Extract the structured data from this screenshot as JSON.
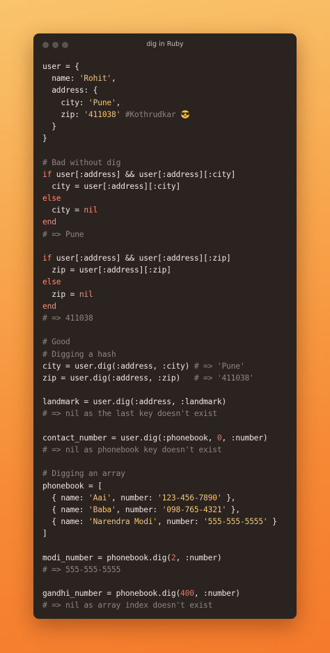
{
  "window": {
    "title": "dig in Ruby"
  },
  "colors": {
    "background": "#2b2320",
    "text": "#ece6e2",
    "keyword": "#ff8a73",
    "string": "#f3c56b",
    "comment": "#8d8580",
    "number": "#f0725b"
  },
  "code": [
    {
      "t": [
        {
          "v": "user = {"
        }
      ]
    },
    {
      "t": [
        {
          "v": "  name: "
        },
        {
          "v": "'Rohit'",
          "c": "str"
        },
        {
          "v": ","
        }
      ]
    },
    {
      "t": [
        {
          "v": "  address: {"
        }
      ]
    },
    {
      "t": [
        {
          "v": "    city: "
        },
        {
          "v": "'Pune'",
          "c": "str"
        },
        {
          "v": ","
        }
      ]
    },
    {
      "t": [
        {
          "v": "    zip: "
        },
        {
          "v": "'411038'",
          "c": "str"
        },
        {
          "v": " "
        },
        {
          "v": "#Kothrudkar 😎",
          "c": "cm"
        }
      ]
    },
    {
      "t": [
        {
          "v": "  }"
        }
      ]
    },
    {
      "t": [
        {
          "v": "}"
        }
      ]
    },
    {
      "t": []
    },
    {
      "t": [
        {
          "v": "# Bad without dig",
          "c": "cm"
        }
      ]
    },
    {
      "t": [
        {
          "v": "if",
          "c": "kw"
        },
        {
          "v": " user[:address] && user[:address][:city]"
        }
      ]
    },
    {
      "t": [
        {
          "v": "  city = user[:address][:city]"
        }
      ]
    },
    {
      "t": [
        {
          "v": "else",
          "c": "kw"
        }
      ]
    },
    {
      "t": [
        {
          "v": "  city = "
        },
        {
          "v": "nil",
          "c": "kw"
        }
      ]
    },
    {
      "t": [
        {
          "v": "end",
          "c": "kw"
        }
      ]
    },
    {
      "t": [
        {
          "v": "# => Pune",
          "c": "cm"
        }
      ]
    },
    {
      "t": []
    },
    {
      "t": [
        {
          "v": "if",
          "c": "kw"
        },
        {
          "v": " user[:address] && user[:address][:zip]"
        }
      ]
    },
    {
      "t": [
        {
          "v": "  zip = user[:address][:zip]"
        }
      ]
    },
    {
      "t": [
        {
          "v": "else",
          "c": "kw"
        }
      ]
    },
    {
      "t": [
        {
          "v": "  zip = "
        },
        {
          "v": "nil",
          "c": "kw"
        }
      ]
    },
    {
      "t": [
        {
          "v": "end",
          "c": "kw"
        }
      ]
    },
    {
      "t": [
        {
          "v": "# => 411038",
          "c": "cm"
        }
      ]
    },
    {
      "t": []
    },
    {
      "t": [
        {
          "v": "# Good",
          "c": "cm"
        }
      ]
    },
    {
      "t": [
        {
          "v": "# Digging a hash",
          "c": "cm"
        }
      ]
    },
    {
      "t": [
        {
          "v": "city = user.dig(:address, :city) "
        },
        {
          "v": "# => 'Pune'",
          "c": "cm"
        }
      ]
    },
    {
      "t": [
        {
          "v": "zip = user.dig(:address, :zip)   "
        },
        {
          "v": "# => '411038'",
          "c": "cm"
        }
      ]
    },
    {
      "t": []
    },
    {
      "t": [
        {
          "v": "landmark = user.dig(:address, :landmark)"
        }
      ]
    },
    {
      "t": [
        {
          "v": "# => nil as the last key doesn't exist",
          "c": "cm"
        }
      ]
    },
    {
      "t": []
    },
    {
      "t": [
        {
          "v": "contact_number = user.dig(:phonebook, "
        },
        {
          "v": "0",
          "c": "num"
        },
        {
          "v": ", :number)"
        }
      ]
    },
    {
      "t": [
        {
          "v": "# => nil as phonebook key doesn't exist",
          "c": "cm"
        }
      ]
    },
    {
      "t": []
    },
    {
      "t": [
        {
          "v": "# Digging an array",
          "c": "cm"
        }
      ]
    },
    {
      "t": [
        {
          "v": "phonebook = ["
        }
      ]
    },
    {
      "t": [
        {
          "v": "  { name: "
        },
        {
          "v": "'Aai'",
          "c": "str"
        },
        {
          "v": ", number: "
        },
        {
          "v": "'123-456-7890'",
          "c": "str"
        },
        {
          "v": " },"
        }
      ]
    },
    {
      "t": [
        {
          "v": "  { name: "
        },
        {
          "v": "'Baba'",
          "c": "str"
        },
        {
          "v": ", number: "
        },
        {
          "v": "'098-765-4321'",
          "c": "str"
        },
        {
          "v": " },"
        }
      ]
    },
    {
      "t": [
        {
          "v": "  { name: "
        },
        {
          "v": "'Narendra Modi'",
          "c": "str"
        },
        {
          "v": ", number: "
        },
        {
          "v": "'555-555-5555'",
          "c": "str"
        },
        {
          "v": " }"
        }
      ]
    },
    {
      "t": [
        {
          "v": "]"
        }
      ]
    },
    {
      "t": []
    },
    {
      "t": [
        {
          "v": "modi_number = phonebook.dig("
        },
        {
          "v": "2",
          "c": "num"
        },
        {
          "v": ", :number)"
        }
      ]
    },
    {
      "t": [
        {
          "v": "# => 555-555-5555",
          "c": "cm"
        }
      ]
    },
    {
      "t": []
    },
    {
      "t": [
        {
          "v": "gandhi_number = phonebook.dig("
        },
        {
          "v": "400",
          "c": "num"
        },
        {
          "v": ", :number)"
        }
      ]
    },
    {
      "t": [
        {
          "v": "# => nil as array index doesn't exist",
          "c": "cm"
        }
      ]
    }
  ]
}
